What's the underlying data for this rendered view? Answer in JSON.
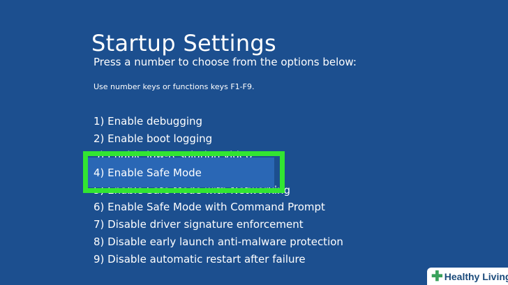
{
  "screen": {
    "title": "Startup Settings",
    "instruction": "Press a number to choose from the options below:",
    "hint": "Use number keys or functions keys F1-F9."
  },
  "options": [
    {
      "label": "1) Enable debugging"
    },
    {
      "label": "2) Enable boot logging"
    },
    {
      "label": "3) Enable low-resolution video"
    },
    {
      "label": "4) Enable Safe Mode"
    },
    {
      "label": "5) Enable Safe Mode with Networking"
    },
    {
      "label": "6) Enable Safe Mode with Command Prompt"
    },
    {
      "label": "7) Disable driver signature enforcement"
    },
    {
      "label": "8) Disable early launch anti-malware protection"
    },
    {
      "label": "9) Disable automatic restart after failure"
    }
  ],
  "selected_option": "4) Enable Safe Mode",
  "watermark": {
    "text": "Healthy Living"
  },
  "colors": {
    "background": "#1c4f8f",
    "selection": "#2a67b5",
    "highlight_frame": "#32e532"
  }
}
